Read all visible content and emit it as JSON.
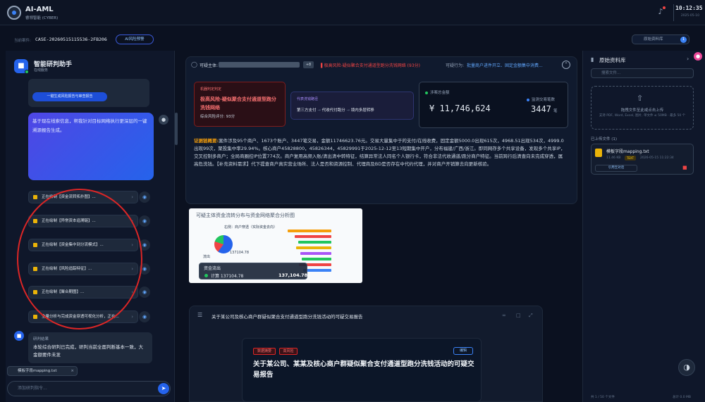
{
  "header": {
    "title": "AI-AML",
    "subtitle": "睿领智能 (CYBER)",
    "time": "10:12:35",
    "date": "2025-05-10"
  },
  "case": {
    "label": "当前案件:",
    "id": "CASE-20260515115536-2FB206",
    "ai_button": "AI风险预警",
    "materials_button": "原始资料库",
    "materials_count": "1"
  },
  "assistant": {
    "title": "智能研判助手",
    "status": "在线服务",
    "generate_button": "一键生成风险报告与审查报告",
    "user_message": "基于现在线索信息，帮我针对目标网络执行更深层的一键溯源报告生成。",
    "tasks": [
      "正在绘制【资金流转拓扑图】...",
      "正在绘制【异常资本追溯链】...",
      "正在绘制【资金集中到分流模式】...",
      "正在绘制【风险追踪特征】...",
      "正在绘制【聚合期图】...",
      "全量分析与完成资金穿透可视化分析，正在..."
    ],
    "result_label": "研判结果",
    "result_text": "本轮综合研判已完成，研判当前全面判断基本一致，大金额要件未发",
    "file_chip": "模板字段mapping.txt",
    "input_placeholder": "添加研判指令..."
  },
  "verdict": {
    "title": "可疑主体:",
    "badge": "+8",
    "risk": "▌极高风险-疑似聚合支付通道型跑分洗钱网络 (93分)",
    "action_label": "可疑行为:",
    "action_value": "批量商户进件开立、固定金额集中消费...",
    "box1_label": "机器判定判定",
    "box1_title": "极高风险-疑似聚合支付通道型跑分洗钱网络",
    "box1_score": "综合风险评分: 93分",
    "box2_label": "代表洗钱路径",
    "box2_flow": [
      "第三方支付",
      "代收代付跑分",
      "境内多层转移"
    ],
    "amount_label": "涉案总金额",
    "amount_value": "¥ 11,746,624",
    "deals_label": "监测交易笔数",
    "deals_value": "3447",
    "deals_unit": "笔",
    "evidence_label": "证据链概要:",
    "evidence_text": "案件涉及95个商户、1673个账户、3447笔交易，金额11746623.76元。交易大量集中于的支付/在线收费，固定金额5000.0出现615次，4968.51出现534次，4999.0出现99次，聚投集中率29.94%。核心商户45828800，45826344，45829991于2025-12-12至13短期集中开户，分布福建/广西/浙江。即同网存多个共享设备，发现多个共享IP，交叉控制多商户；全局商圈控IP位置774次。商户复用高频入账/清出清中转特征，结算异常法人同名个人银行卡，符合非法代收通道/跑分商户特征。当前跨行后清查向未完成穿透，属高危洗钱。【补充资料需求】代下提查商户真实营业场所、法人是否和资源控制、代理商及BD是否存在中代约代理，并对商户开销算去向更新核验。"
  },
  "chart_preview": {
    "title": "可疑主体资金流转分布与资金网络聚合分析图",
    "row_label": "右侧：商户穿透（实际资金去向）",
    "tooltip_title": "资金流出",
    "tooltip_left": "计算 137104.78",
    "tooltip_value": "137,104.78",
    "point_a": "137104.78",
    "point_b": "流出"
  },
  "report": {
    "title": "关于某公司及核心商户群疑似聚合支付通道型跑分洗钱活动的可疑交易报告",
    "tag1": "数据摘要",
    "tag2": "高风险",
    "edit_button": "编辑",
    "heading": "关于某公司、某某及核心商户群疑似聚合支付通道型跑分洗钱活动的可疑交易报告"
  },
  "right": {
    "title": "原始资料库",
    "search_placeholder": "搜索文件...",
    "upload_title": "拖拽文件至此或点击上传",
    "upload_hint": "支持 PDF, Word, Excel, 图片, 单文件 ≤ 50MB · 最多 50 个",
    "uploaded_label": "已上传文件 (1)",
    "file_name": "模板字段mapping.txt",
    "file_size": "11.46 KB",
    "file_type": "TEXT",
    "file_date": "2026-05-15 11:22:34",
    "ref_button": "引用至对话",
    "footer_left": "共 1 / 50 个文件",
    "footer_right": "总计 0.0 MB"
  },
  "colors": {
    "accent": "#2563eb",
    "danger": "#ef4444",
    "warning": "#f59e0b",
    "success": "#22c55e"
  }
}
